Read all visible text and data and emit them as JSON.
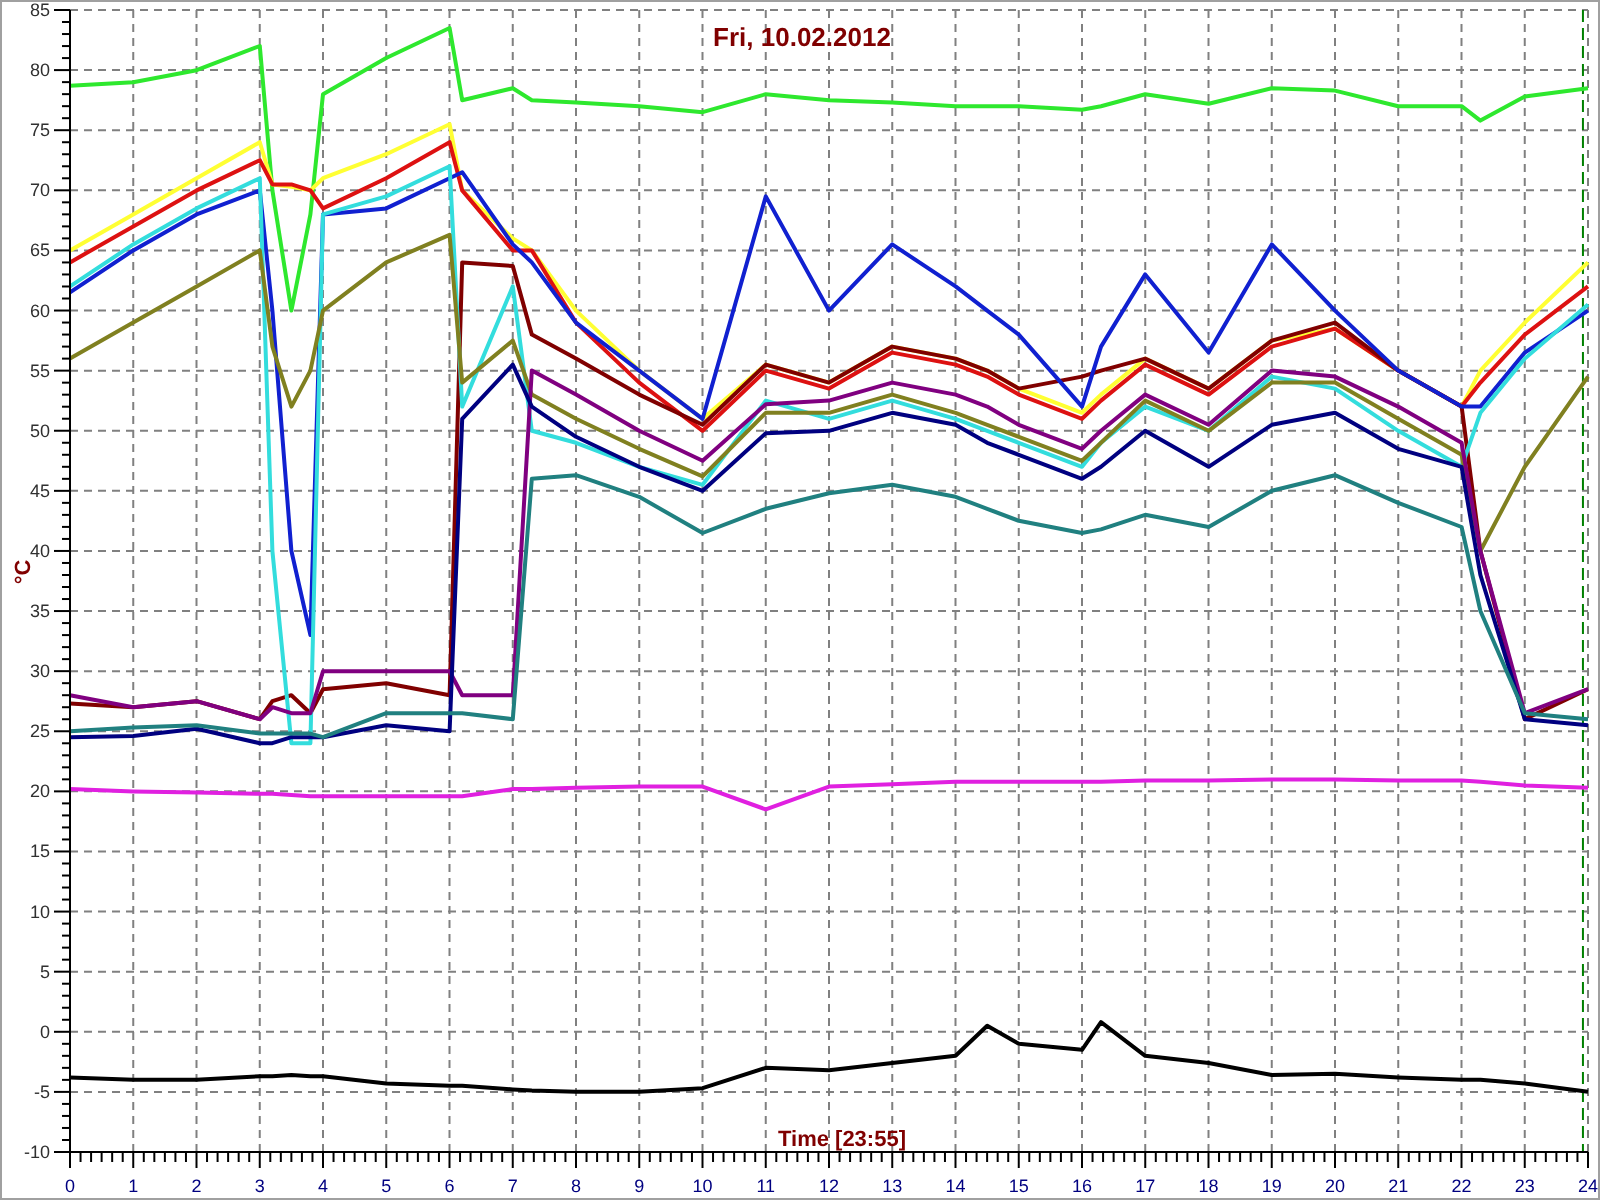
{
  "chart": {
    "chart_data": {
      "type": "line",
      "title": "Fri, 10.02.2012",
      "xlabel": "Time [23:55]",
      "ylabel": "°C",
      "grid": true,
      "ref_lines": [
        {
          "axis": "x",
          "value": 23.92,
          "color": "#008000"
        }
      ],
      "x": [
        0,
        1,
        2,
        3,
        3.2,
        3.5,
        3.8,
        4,
        5,
        6,
        6.2,
        7,
        7.3,
        8,
        9,
        10,
        11,
        12,
        13,
        14,
        14.5,
        15,
        16,
        16.3,
        17,
        18,
        19,
        20,
        21,
        22,
        22.3,
        23,
        24
      ],
      "series": [
        {
          "color": "#2ee82e",
          "values": [
            78.7,
            79,
            80,
            82,
            70,
            60,
            68,
            78,
            81,
            83.5,
            77.5,
            78.5,
            77.5,
            77.3,
            77,
            76.5,
            78,
            77.5,
            77.3,
            77,
            77,
            77,
            76.7,
            77,
            78,
            77.2,
            78.5,
            78.3,
            77,
            77,
            75.8,
            77.8,
            78.5
          ]
        },
        {
          "color": "#ffff33",
          "values": [
            65,
            68,
            71,
            74,
            70.5,
            70.3,
            70,
            71,
            73,
            75.5,
            70,
            66,
            65,
            60,
            55,
            51,
            55.5,
            54,
            57,
            56,
            55,
            53.5,
            51.5,
            53,
            56,
            53.5,
            57.5,
            58.5,
            55,
            52,
            55,
            59,
            64
          ]
        },
        {
          "color": "#dd1111",
          "values": [
            64,
            67,
            70,
            72.5,
            70.5,
            70.5,
            70,
            68.5,
            71,
            74,
            70,
            65,
            65,
            59,
            54,
            50,
            55,
            53.5,
            56.5,
            55.5,
            54.5,
            53,
            51,
            52.5,
            55.5,
            53,
            57,
            58.5,
            55,
            52,
            54,
            58,
            62
          ]
        },
        {
          "color": "#800000",
          "values": [
            27.3,
            27,
            27.5,
            26,
            27.5,
            28,
            26.5,
            28.5,
            29,
            28,
            64,
            63.7,
            58,
            56,
            53,
            50.5,
            55.5,
            54,
            57,
            56,
            55,
            53.5,
            54.5,
            55,
            56,
            53.5,
            57.5,
            59,
            55,
            52,
            40,
            26,
            28.5
          ]
        },
        {
          "color": "#1020d0",
          "values": [
            61.5,
            65,
            68,
            70,
            60,
            40,
            33,
            68,
            68.5,
            71,
            71.5,
            65.5,
            64,
            59,
            55,
            51,
            69.5,
            60,
            65.5,
            62,
            60,
            58,
            52,
            57,
            63,
            56.5,
            65.5,
            60,
            55,
            52,
            52,
            56.5,
            60
          ]
        },
        {
          "color": "#33dddd",
          "values": [
            62,
            65.5,
            68.5,
            71,
            40,
            24,
            24,
            68,
            69.5,
            72,
            52,
            62,
            50,
            49,
            47,
            45.5,
            52.5,
            51,
            52.5,
            51,
            50,
            49,
            47,
            49,
            52,
            50,
            54.5,
            53.5,
            50,
            47,
            51.5,
            56,
            60.5
          ]
        },
        {
          "color": "#808020",
          "values": [
            56,
            59,
            62,
            65,
            57,
            52,
            55,
            60,
            64,
            66.3,
            54,
            57.5,
            53,
            51,
            48.5,
            46.2,
            51.5,
            51.5,
            53,
            51.5,
            50.5,
            49.5,
            47.5,
            49,
            52.5,
            50,
            54,
            54,
            51,
            48,
            40,
            47,
            54.5
          ]
        },
        {
          "color": "#800080",
          "values": [
            28,
            27,
            27.5,
            26,
            27,
            26.5,
            26.5,
            30,
            30,
            30,
            28,
            28,
            55,
            53,
            50,
            47.5,
            52.2,
            52.5,
            54,
            53,
            52,
            50.5,
            48.5,
            50,
            53,
            50.5,
            55,
            54.5,
            52,
            49,
            40,
            26.5,
            28.5
          ]
        },
        {
          "color": "#000080",
          "values": [
            24.5,
            24.6,
            25.2,
            24,
            24,
            24.5,
            24.5,
            24.5,
            25.5,
            25,
            51,
            55.5,
            52,
            49.5,
            47,
            45,
            49.8,
            50,
            51.5,
            50.5,
            49,
            48,
            46,
            47,
            50,
            47,
            50.5,
            51.5,
            48.5,
            47,
            38,
            26,
            25.5
          ]
        },
        {
          "color": "#208080",
          "values": [
            25,
            25.3,
            25.5,
            24.8,
            24.8,
            24.8,
            24.8,
            24.5,
            26.5,
            26.5,
            26.5,
            26,
            46,
            46.3,
            44.5,
            41.5,
            43.5,
            44.8,
            45.5,
            44.5,
            43.5,
            42.5,
            41.5,
            41.8,
            43,
            42,
            45,
            46.3,
            44,
            42,
            35,
            26.5,
            26
          ]
        },
        {
          "color": "#e020e0",
          "values": [
            20.2,
            20,
            19.9,
            19.8,
            19.8,
            19.7,
            19.6,
            19.6,
            19.6,
            19.6,
            19.6,
            20.2,
            20.2,
            20.3,
            20.4,
            20.4,
            18.5,
            20.4,
            20.6,
            20.8,
            20.8,
            20.8,
            20.8,
            20.8,
            20.9,
            20.9,
            21,
            21,
            20.9,
            20.9,
            20.8,
            20.5,
            20.3
          ]
        },
        {
          "color": "#000000",
          "values": [
            -3.8,
            -4,
            -4,
            -3.7,
            -3.7,
            -3.6,
            -3.7,
            -3.7,
            -4.3,
            -4.5,
            -4.5,
            -4.8,
            -4.9,
            -5,
            -5,
            -4.7,
            -3,
            -3.2,
            -2.6,
            -2,
            0.5,
            -1,
            -1.5,
            0.8,
            -2,
            -2.6,
            -3.6,
            -3.5,
            -3.8,
            -4,
            -4,
            -4.3,
            -5
          ]
        }
      ],
      "xlim": [
        0,
        24
      ],
      "ylim": [
        -10,
        85
      ],
      "xticks": [
        0,
        1,
        2,
        3,
        4,
        5,
        6,
        7,
        8,
        9,
        10,
        11,
        12,
        13,
        14,
        15,
        16,
        17,
        18,
        19,
        20,
        21,
        22,
        23,
        24
      ],
      "yticks": [
        -10,
        -5,
        0,
        5,
        10,
        15,
        20,
        25,
        30,
        35,
        40,
        45,
        50,
        55,
        60,
        65,
        70,
        75,
        80,
        85
      ]
    }
  }
}
